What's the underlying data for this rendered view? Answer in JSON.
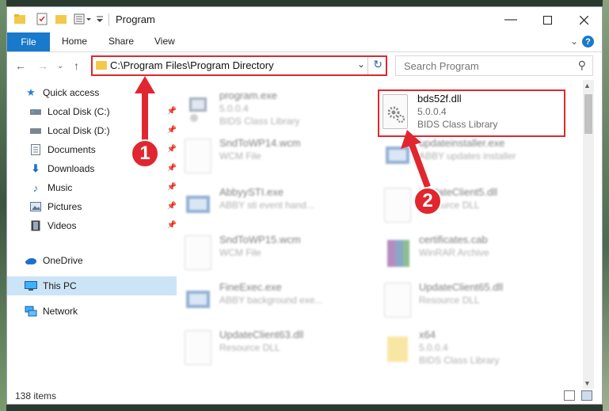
{
  "window": {
    "title": "Program"
  },
  "ribbon": {
    "file": "File",
    "tabs": [
      "Home",
      "Share",
      "View"
    ],
    "help": "?"
  },
  "address": {
    "path": "C:\\Program Files\\Program Directory"
  },
  "search": {
    "placeholder": "Search Program"
  },
  "sidebar": {
    "items": [
      {
        "label": "Quick access",
        "icon": "star-icon"
      },
      {
        "label": "Local Disk (C:)",
        "icon": "drive-icon"
      },
      {
        "label": "Local Disk (D:)",
        "icon": "drive-icon"
      },
      {
        "label": "Documents",
        "icon": "documents-icon"
      },
      {
        "label": "Downloads",
        "icon": "downloads-icon"
      },
      {
        "label": "Music",
        "icon": "music-icon"
      },
      {
        "label": "Pictures",
        "icon": "pictures-icon"
      },
      {
        "label": "Videos",
        "icon": "videos-icon"
      },
      {
        "label": "OneDrive",
        "icon": "cloud-icon"
      },
      {
        "label": "This PC",
        "icon": "pc-icon"
      },
      {
        "label": "Network",
        "icon": "network-icon"
      }
    ]
  },
  "files": [
    {
      "name": "program.exe",
      "l1": "5.0.0.4",
      "l2": "BIDS Class Library"
    },
    {
      "name": "bds52f.dll",
      "l1": "5.0.0.4",
      "l2": "BIDS Class Library"
    },
    {
      "name": "SndToWP14.wcm",
      "l1": "WCM File",
      "l2": ""
    },
    {
      "name": "updateinstaller.exe",
      "l1": "ABBY updates installer",
      "l2": ""
    },
    {
      "name": "AbbyySTI.exe",
      "l1": "ABBY sti event hand...",
      "l2": ""
    },
    {
      "name": "UpdateClient5.dll",
      "l1": "Resource DLL",
      "l2": ""
    },
    {
      "name": "SndToWP15.wcm",
      "l1": "WCM File",
      "l2": ""
    },
    {
      "name": "certificates.cab",
      "l1": "WinRAR Archive",
      "l2": ""
    },
    {
      "name": "FineExec.exe",
      "l1": "ABBY background exe...",
      "l2": ""
    },
    {
      "name": "UpdateClient65.dll",
      "l1": "Resource DLL",
      "l2": ""
    },
    {
      "name": "UpdateClient63.dll",
      "l1": "Resource DLL",
      "l2": ""
    },
    {
      "name": "x64",
      "l1": "5.0.0.4",
      "l2": "BIDS Class Library"
    }
  ],
  "status": {
    "count": "138 items"
  },
  "callouts": [
    "1",
    "2"
  ]
}
